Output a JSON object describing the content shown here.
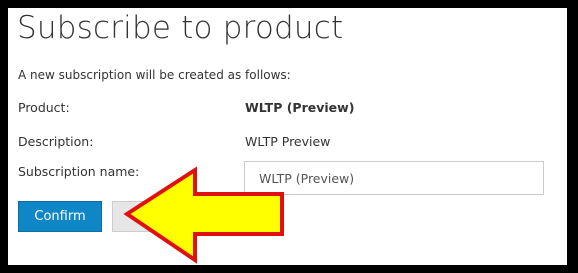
{
  "dialog": {
    "title": "Subscribe to product",
    "subtitle": "A new subscription will be created as follows:"
  },
  "details": {
    "product_label": "Product:",
    "product_value": "WLTP (Preview)",
    "description_label": "Description:",
    "description_value": "WLTP Preview",
    "subscription_name_label": "Subscription name:",
    "subscription_name_value": "WLTP (Preview)"
  },
  "actions": {
    "confirm_label": "Confirm",
    "cancel_label": ""
  },
  "annotation": {
    "arrow_icon": "arrow-left-icon",
    "arrow_fill": "#ffff00",
    "arrow_stroke": "#e01010"
  },
  "colors": {
    "background_border": "#000000",
    "confirm_button": "#0f87c6"
  }
}
